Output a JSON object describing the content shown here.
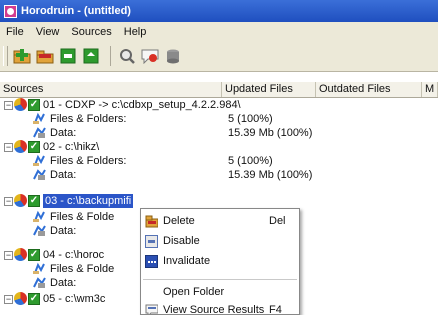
{
  "window": {
    "title": "Horodruin - (untitled)"
  },
  "menu": [
    "File",
    "View",
    "Sources",
    "Help"
  ],
  "toolbar": {
    "buttons": [
      "add-source-icon",
      "remove-source-icon",
      "enable-icon",
      "refresh-icon",
      "search-icon",
      "comment-icon",
      "disk-icon"
    ]
  },
  "columns": [
    "Sources",
    "Updated Files",
    "Outdated Files",
    "M"
  ],
  "tree": {
    "rows": [
      {
        "type": "source",
        "label": "01 - CDXP -> c:\\cdbxp_setup_4.2.2.984\\"
      },
      {
        "type": "detail",
        "label": "Files & Folders:",
        "value": "5 (100%)"
      },
      {
        "type": "detail",
        "label": "Data:",
        "value": "15.39 Mb (100%)"
      },
      {
        "type": "source",
        "label": "02 - c:\\hikz\\"
      },
      {
        "type": "detail",
        "label": "Files & Folders:",
        "value": "5 (100%)"
      },
      {
        "type": "detail",
        "label": "Data:",
        "value": "15.39 Mb (100%)"
      },
      {
        "type": "source",
        "label": "03 - c:\\backupmifi",
        "selected": true
      },
      {
        "type": "detail",
        "label": "Files & Folde"
      },
      {
        "type": "detail",
        "label": "Data:"
      },
      {
        "type": "source",
        "label": "04 - c:\\horoc"
      },
      {
        "type": "detail",
        "label": "Files & Folde"
      },
      {
        "type": "detail",
        "label": "Data:"
      },
      {
        "type": "source",
        "label": "05 - c:\\wm3c"
      }
    ]
  },
  "context_menu": {
    "items": [
      {
        "label": "Delete",
        "shortcut": "Del",
        "icon": "delete-icon"
      },
      {
        "label": "Disable",
        "shortcut": "",
        "icon": "disable-icon"
      },
      {
        "label": "Invalidate",
        "shortcut": "",
        "icon": "invalidate-icon"
      },
      {
        "label": "Open Folder",
        "shortcut": "",
        "icon": ""
      },
      {
        "label": "View Source Results",
        "shortcut": "F4",
        "icon": "view-results-icon"
      }
    ]
  },
  "colors": {
    "titlebar": "#2a5bd0",
    "selection": "#2b55c8",
    "check": "#2e9b2e"
  }
}
